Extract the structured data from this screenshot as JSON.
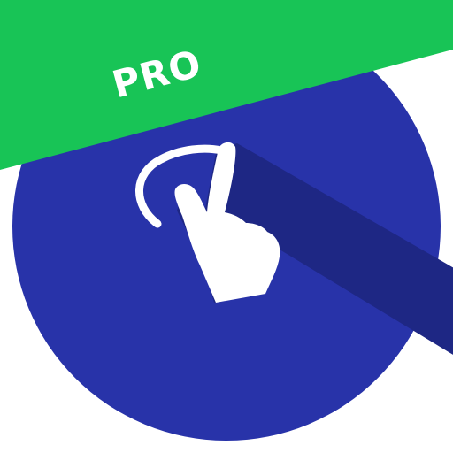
{
  "app_icon": {
    "badge_text": "PRO",
    "icon_name": "two-finger-gesture-icon",
    "colors": {
      "circle": "#2833a9",
      "shadow": "#1e2784",
      "ribbon": "#18c456",
      "badge_text": "#ffffff",
      "hand": "#ffffff"
    }
  }
}
